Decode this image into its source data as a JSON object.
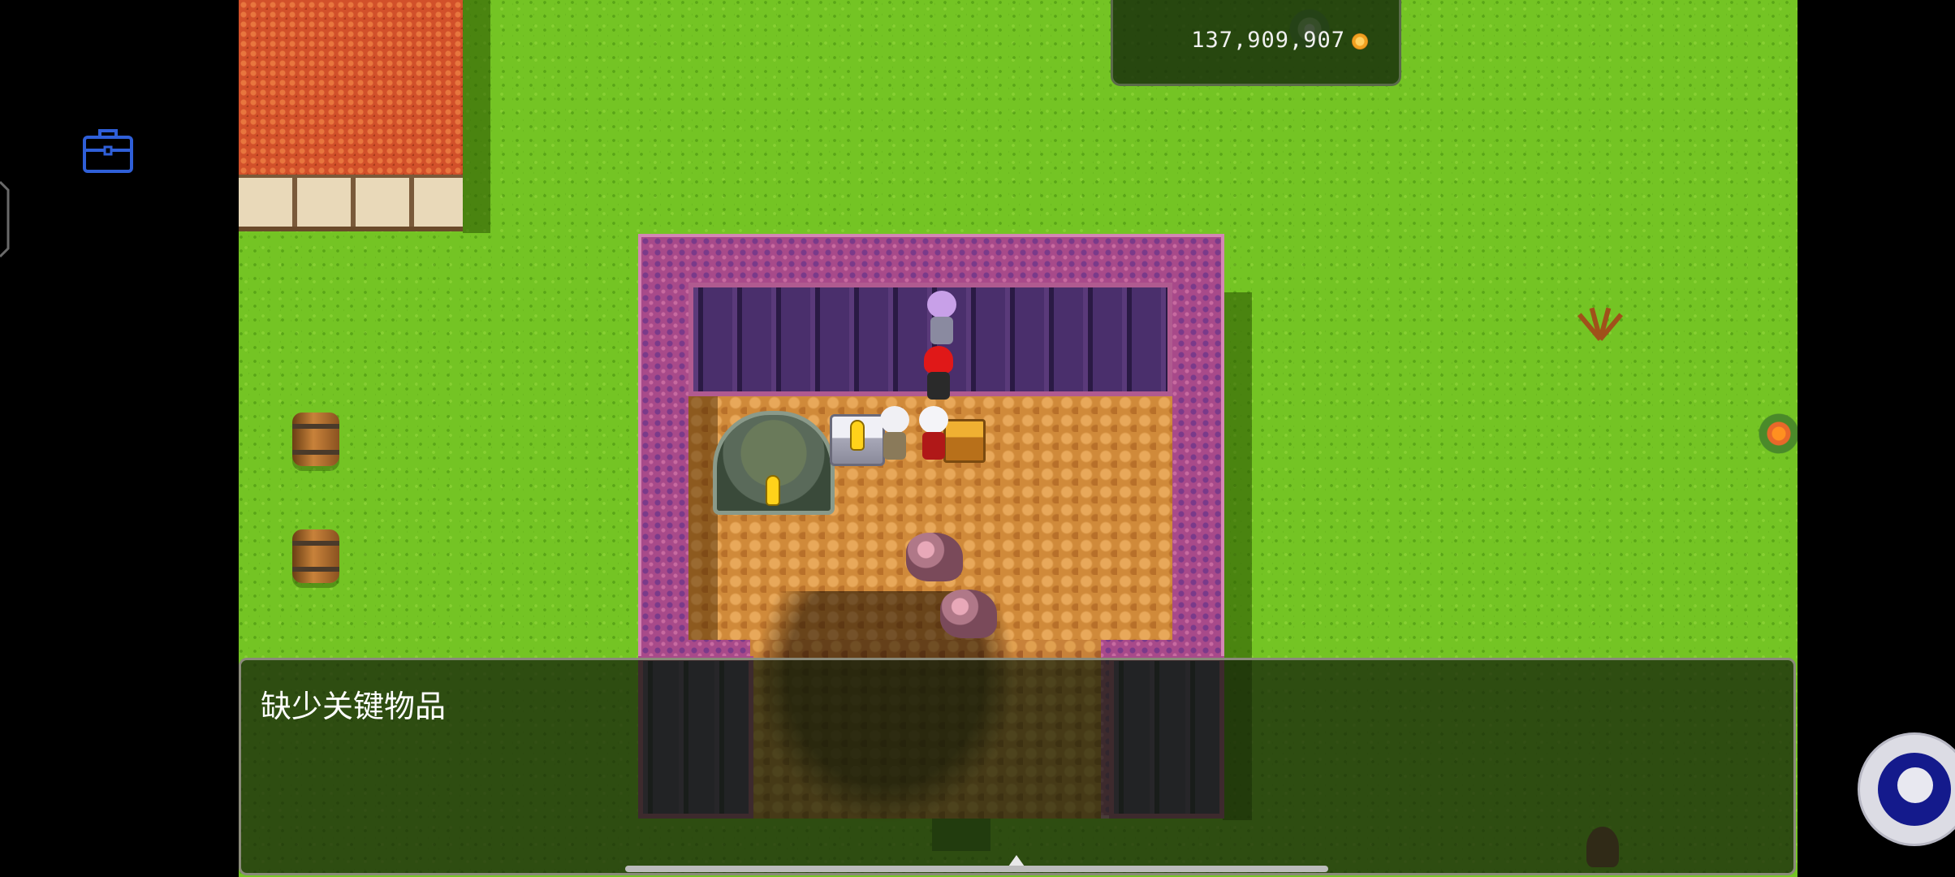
{
  "hud": {
    "gold_amount": "137,909,907",
    "gold_icon": "coin-icon"
  },
  "message_window": {
    "text": "缺少关键物品"
  },
  "system_ui": {
    "left_button_icon": "briefcase-icon",
    "right_button_icon": "assistive-touch-icon"
  },
  "colors": {
    "grass": "#74c424",
    "temple_wall": "#a84a8a",
    "floor": "#d08a3a",
    "quest_marker": "#ffd21a",
    "inventory_icon": "#2f5fd8",
    "assistive_button": "#141a8c"
  }
}
